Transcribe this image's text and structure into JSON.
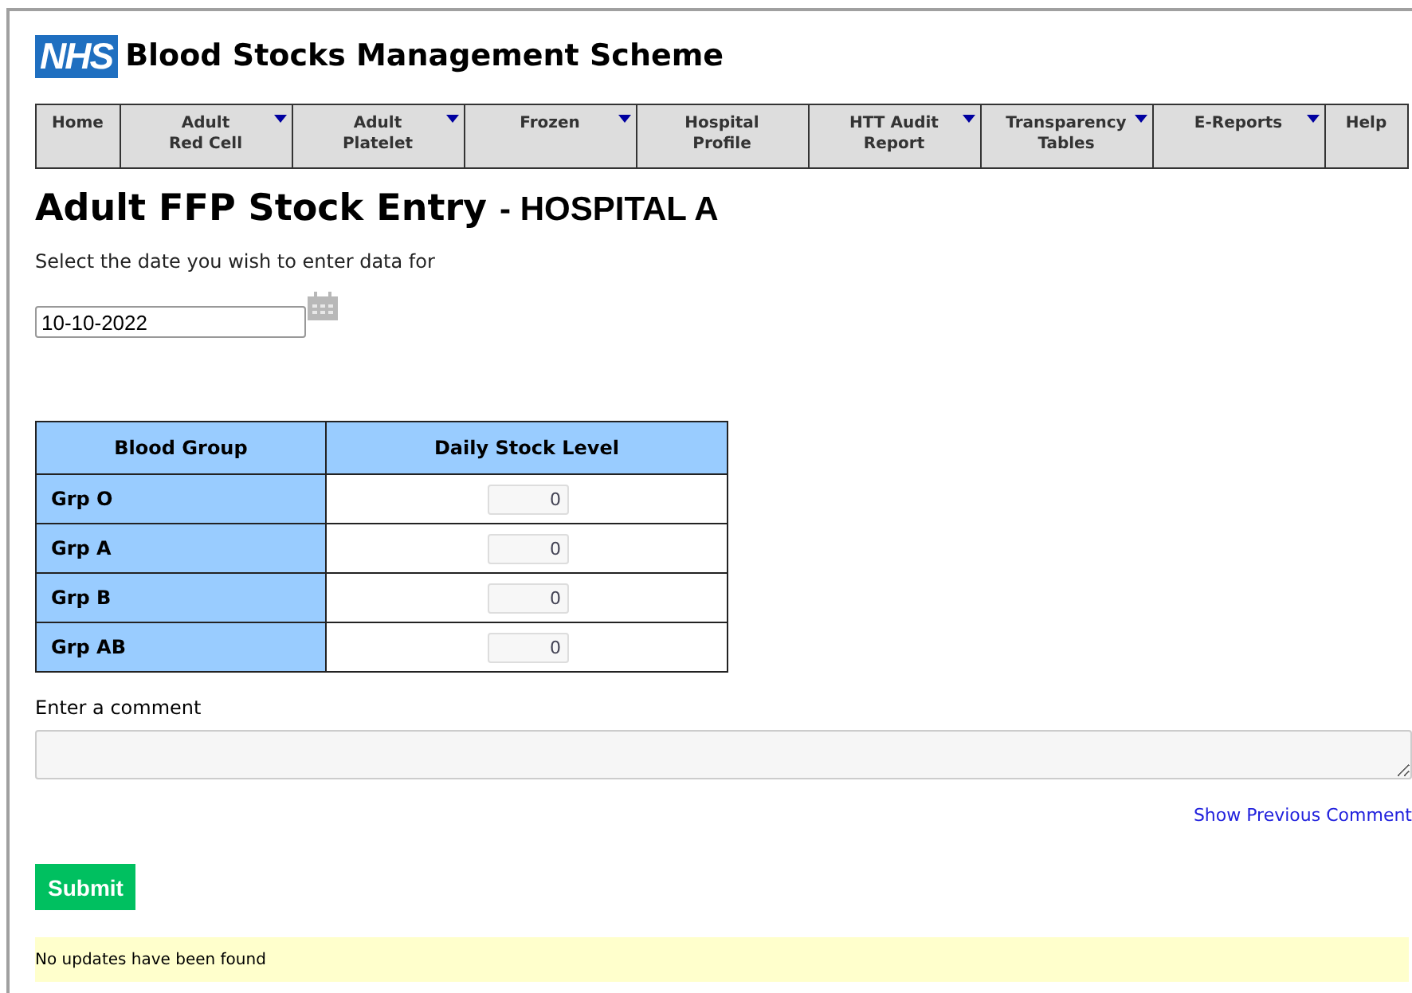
{
  "header": {
    "logo": "NHS",
    "title": "Blood Stocks Management Scheme"
  },
  "nav": [
    {
      "lines": [
        "Home"
      ],
      "dropdown": false
    },
    {
      "lines": [
        "Adult",
        "Red Cell"
      ],
      "dropdown": true
    },
    {
      "lines": [
        "Adult",
        "Platelet"
      ],
      "dropdown": true
    },
    {
      "lines": [
        "Frozen"
      ],
      "dropdown": true
    },
    {
      "lines": [
        "Hospital",
        "Profile"
      ],
      "dropdown": false
    },
    {
      "lines": [
        "HTT Audit",
        "Report"
      ],
      "dropdown": true
    },
    {
      "lines": [
        "Transparency",
        "Tables"
      ],
      "dropdown": true
    },
    {
      "lines": [
        "E-Reports"
      ],
      "dropdown": true
    },
    {
      "lines": [
        "Help"
      ],
      "dropdown": false
    }
  ],
  "page_title": "Adult FFP Stock Entry",
  "hospital": "- HOSPITAL A",
  "date_prompt": "Select the date you wish to enter data for",
  "date_field": {
    "value": "10-10-2022"
  },
  "table": {
    "columns": [
      "Blood Group",
      "Daily Stock Level"
    ],
    "rows": [
      {
        "group": "Grp O",
        "value": "0"
      },
      {
        "group": "Grp A",
        "value": "0"
      },
      {
        "group": "Grp B",
        "value": "0"
      },
      {
        "group": "Grp AB",
        "value": "0"
      }
    ]
  },
  "comment_label": "Enter a comment",
  "previous_comment_link": "Show Previous Comment",
  "submit": "Submit",
  "status_message": "No updates have been found"
}
